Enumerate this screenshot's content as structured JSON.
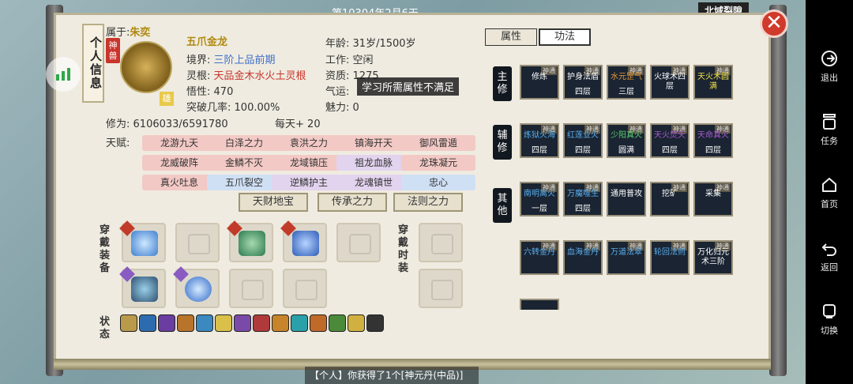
{
  "top": {
    "date": "第10304年2月6天",
    "region": "北域裂隙"
  },
  "panel_tag": "个人信息",
  "attribution": {
    "label": "属于:",
    "owner": "朱奕"
  },
  "rank_badge": "神兽",
  "gender": "雄",
  "char": {
    "name": "五爪金龙",
    "realm_label": "境界:",
    "realm": "三阶上品前期",
    "root_label": "灵根:",
    "root": "天品金木水火土灵根",
    "insight_label": "悟性:",
    "insight": "470",
    "breakthrough_label": "突破几率:",
    "breakthrough": "100.00%",
    "cultivation_label": "修为:",
    "cultivation": "6106033/6591780",
    "per_day_label": "每天+",
    "per_day": "20",
    "age_label": "年龄:",
    "age": "31岁/1500岁",
    "job_label": "工作:",
    "job": "空闲",
    "qualification_label": "资质:",
    "qualification": "1275",
    "luck_label": "气运:",
    "charm_label": "魅力:",
    "charm": "0"
  },
  "tooltip": "学习所需属性不满足",
  "talent_label": "天赋:",
  "talents": [
    "龙游九天",
    "白泽之力",
    "袁洪之力",
    "镇海开天",
    "御风雷遁",
    "龙威破阵",
    "金鳞不灭",
    "龙域镇压",
    "祖龙血脉",
    "龙珠凝元",
    "真火吐息",
    "五爪裂空",
    "逆鳞护主",
    "龙魂镇世",
    "忠心"
  ],
  "section_buttons": [
    "天财地宝",
    "传承之力",
    "法则之力"
  ],
  "equip_label": "穿戴装备",
  "fashion_label": "穿戴时装",
  "state_label": "状态",
  "tabs": [
    "属性",
    "功法"
  ],
  "skill_sections": {
    "main": "主修",
    "aux": "辅修",
    "other": "其他"
  },
  "skills_main": [
    {
      "badge": "神通",
      "name": "修炼",
      "level": ""
    },
    {
      "badge": "神通",
      "name": "护身法盾",
      "level": "四层"
    },
    {
      "badge": "神通",
      "name": "水元罡气",
      "level": "三层"
    },
    {
      "badge": "神通",
      "name": "火球术四层",
      "level": ""
    },
    {
      "badge": "神通",
      "name": "天火术圆满",
      "level": ""
    }
  ],
  "skills_aux": [
    {
      "badge": "神通",
      "name": "炼狱火海",
      "level": "四层"
    },
    {
      "badge": "神通",
      "name": "红莲业火",
      "level": "四层"
    },
    {
      "badge": "神通",
      "name": "少阳真火",
      "level": "圆满"
    },
    {
      "badge": "神通",
      "name": "天火焚天",
      "level": "四层"
    },
    {
      "badge": "神通",
      "name": "天命真火",
      "level": "四层"
    }
  ],
  "skills_other_1": [
    {
      "badge": "神通",
      "name": "南明离火",
      "level": "一层"
    },
    {
      "badge": "神通",
      "name": "万魔噬生",
      "level": "四层"
    },
    {
      "badge": "",
      "name": "通用普攻",
      "level": ""
    },
    {
      "badge": "神通",
      "name": "挖矿",
      "level": ""
    },
    {
      "badge": "神通",
      "name": "采集",
      "level": ""
    }
  ],
  "skills_other_2": [
    {
      "badge": "神通",
      "name": "六转金丹",
      "level": ""
    },
    {
      "badge": "神通",
      "name": "血海金丹",
      "level": ""
    },
    {
      "badge": "神通",
      "name": "万道法翠",
      "level": ""
    },
    {
      "badge": "神通",
      "name": "轮回法则",
      "level": ""
    },
    {
      "badge": "神通",
      "name": "万化归元术三阶",
      "level": ""
    }
  ],
  "bottom_message": "【个人】你获得了1个[神元丹(中品)]",
  "nav": [
    {
      "label": "退出",
      "icon": "exit-icon"
    },
    {
      "label": "任务",
      "icon": "task-icon"
    },
    {
      "label": "首页",
      "icon": "home-icon"
    },
    {
      "label": "返回",
      "icon": "back-icon"
    },
    {
      "label": "切换",
      "icon": "switch-icon"
    }
  ]
}
